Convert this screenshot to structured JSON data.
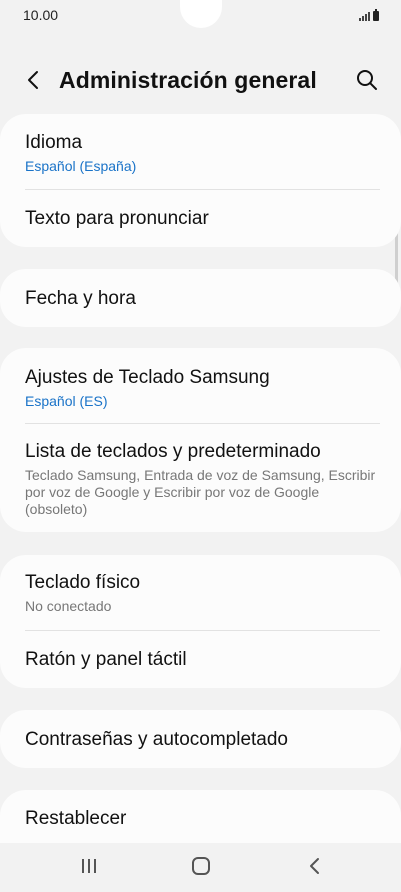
{
  "status": {
    "time": "10.00"
  },
  "header": {
    "title": "Administración general"
  },
  "groups": {
    "g1": {
      "idioma": {
        "label": "Idioma",
        "sub": "Español (España)"
      },
      "tts": {
        "label": "Texto para pronunciar"
      }
    },
    "g2": {
      "fecha": {
        "label": "Fecha y hora"
      }
    },
    "g3": {
      "teclado_samsung": {
        "label": "Ajustes de Teclado Samsung",
        "sub": "Español (ES)"
      },
      "lista_teclados": {
        "label": "Lista de teclados y predeterminado",
        "desc": "Teclado Samsung, Entrada de voz de Samsung, Escribir por voz de Google y Escribir por voz de Google (obsoleto)"
      }
    },
    "g4": {
      "teclado_fisico": {
        "label": "Teclado físico",
        "sub": "No conectado"
      },
      "raton": {
        "label": "Ratón y panel táctil"
      }
    },
    "g5": {
      "contrasenas": {
        "label": "Contraseñas y autocompletado"
      }
    },
    "g6": {
      "restablecer": {
        "label": "Restablecer"
      }
    }
  },
  "colors": {
    "accent": "#1a73c8",
    "background": "#f2f2f2",
    "card": "#fcfcfc"
  },
  "icons": [
    "back-arrow-icon",
    "search-icon",
    "signal-icon",
    "battery-icon",
    "recent-apps-icon",
    "home-icon",
    "nav-back-icon"
  ]
}
